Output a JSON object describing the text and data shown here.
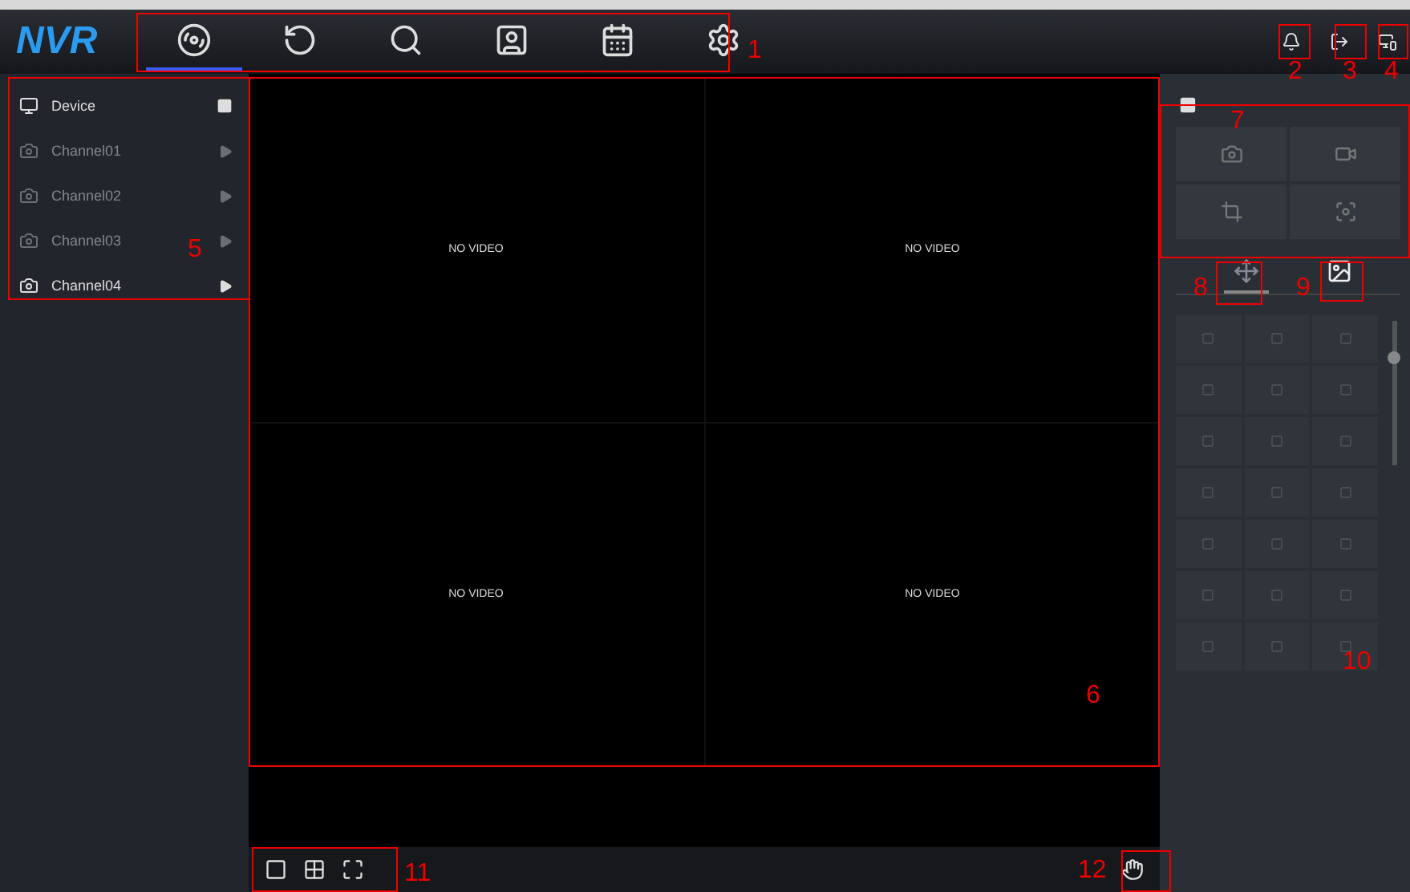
{
  "app": {
    "logo": "NVR"
  },
  "main_menu": [
    {
      "kind": "live",
      "selected": true
    },
    {
      "kind": "playback",
      "selected": false
    },
    {
      "kind": "search",
      "selected": false
    },
    {
      "kind": "face",
      "selected": false
    },
    {
      "kind": "calendar",
      "selected": false
    },
    {
      "kind": "settings",
      "selected": false
    }
  ],
  "device_tree": {
    "root": "Device",
    "channels": [
      {
        "name": "Channel01",
        "disabled": true
      },
      {
        "name": "Channel02",
        "disabled": true
      },
      {
        "name": "Channel03",
        "disabled": true
      },
      {
        "name": "Channel04",
        "disabled": false
      }
    ]
  },
  "video_tiles": [
    {
      "status": "NO VIDEO"
    },
    {
      "status": "NO VIDEO"
    },
    {
      "status": "NO VIDEO"
    },
    {
      "status": "NO VIDEO"
    }
  ],
  "speed_slider": {
    "level": 0.75
  },
  "control_tabs": [
    {
      "kind": "ptz",
      "selected": true
    },
    {
      "kind": "image",
      "selected": false
    }
  ],
  "callouts": [
    "1",
    "2",
    "3",
    "4",
    "5",
    "6",
    "7",
    "8",
    "9",
    "10",
    "11",
    "12"
  ]
}
